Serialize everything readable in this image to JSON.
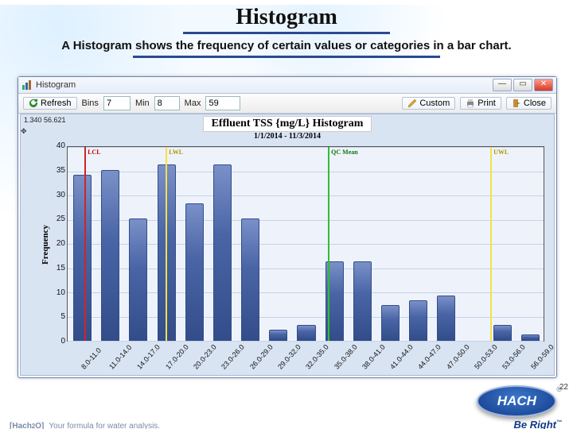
{
  "page": {
    "title": "Histogram",
    "subtitle": "A Histogram shows the frequency of certain values or categories in a bar chart.",
    "number": "22"
  },
  "window": {
    "title": "Histogram",
    "buttons": {
      "min": "—",
      "max": "▭",
      "close": "✕"
    }
  },
  "toolbar": {
    "refresh": "Refresh",
    "bins_label": "Bins",
    "bins_value": "7",
    "min_label": "Min",
    "min_value": "8",
    "max_label": "Max",
    "max_value": "59",
    "custom": "Custom",
    "print": "Print",
    "close": "Close"
  },
  "chart": {
    "coord": "1.340  56.621",
    "title": "Effluent TSS {mg/L} Histogram",
    "subtitle": "1/1/2014 - 11/3/2014",
    "ylabel": "Frequency"
  },
  "markers": {
    "lcl": "LCL",
    "lwl": "LWL",
    "qcmean": "QC Mean",
    "uwl": "UWL"
  },
  "footer": {
    "brand": "HACH",
    "tagline": "Be Right",
    "logo_main": "Hach",
    "logo_sub": "2",
    "logo_sub2": "O",
    "logo_tag": "Your formula for water analysis."
  },
  "chart_data": {
    "type": "bar",
    "title": "Effluent TSS {mg/L} Histogram",
    "subtitle": "1/1/2014 - 11/3/2014",
    "xlabel": "",
    "ylabel": "Frequency",
    "ylim": [
      0,
      40
    ],
    "yticks": [
      0,
      5,
      10,
      15,
      20,
      25,
      30,
      35,
      40
    ],
    "categories": [
      "8.0-11.0",
      "11.0-14.0",
      "14.0-17.0",
      "17.0-20.0",
      "20.0-23.0",
      "23.0-26.0",
      "26.0-29.0",
      "29.0-32.0",
      "32.0-35.0",
      "35.0-38.0",
      "38.0-41.0",
      "41.0-44.0",
      "44.0-47.0",
      "47.0-50.0",
      "50.0-53.0",
      "53.0-56.0",
      "56.0-59.0"
    ],
    "values": [
      34,
      35,
      25,
      36,
      28,
      36,
      25,
      2,
      3,
      16,
      16,
      7,
      8,
      9,
      0,
      3,
      1
    ],
    "reference_lines": [
      {
        "name": "LCL",
        "position_bin_index": 0.6,
        "color": "red"
      },
      {
        "name": "LWL",
        "position_bin_index": 3.5,
        "color": "yellow"
      },
      {
        "name": "QC Mean",
        "position_bin_index": 9.3,
        "color": "green"
      },
      {
        "name": "UWL",
        "position_bin_index": 15.1,
        "color": "yellow"
      }
    ]
  }
}
